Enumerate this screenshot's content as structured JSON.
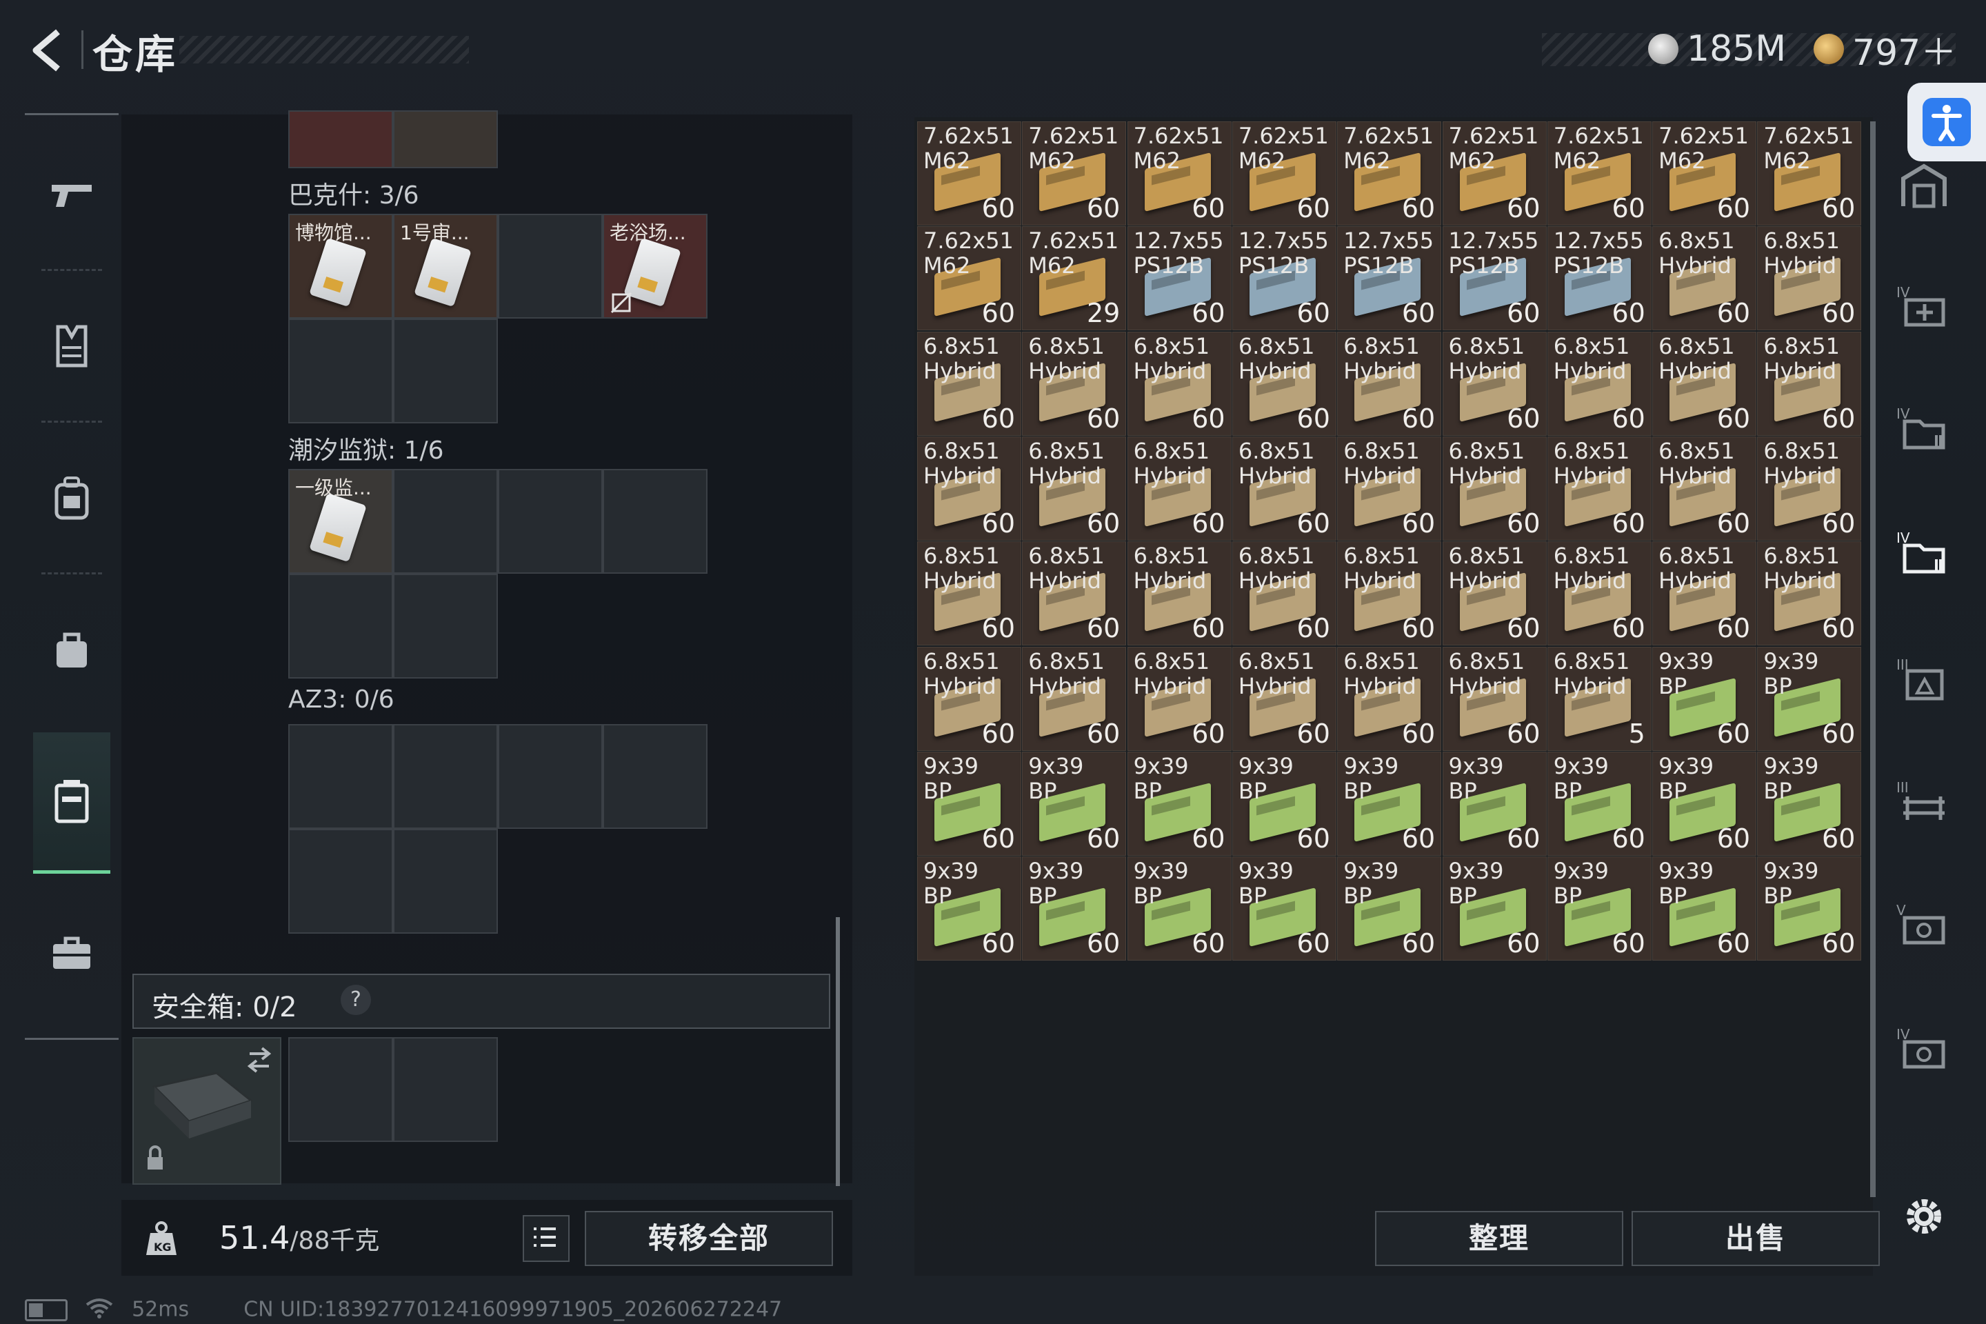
{
  "header": {
    "title": "仓库"
  },
  "currency": [
    {
      "name": "silver-coin",
      "value": "185M",
      "color": "#c8c8c8"
    },
    {
      "name": "gold-coin",
      "value": "797＋",
      "color": "#d4a04a"
    }
  ],
  "left_nav": [
    {
      "icon": "pistol-icon"
    },
    {
      "icon": "vest-icon"
    },
    {
      "icon": "backpack-icon"
    },
    {
      "icon": "bag-icon"
    },
    {
      "icon": "case-icon",
      "active": true
    },
    {
      "icon": "briefcase-icon"
    }
  ],
  "containers": [
    {
      "label": "巴克什: 3/6",
      "cells": [
        {
          "label": "博物馆..."
        },
        {
          "label": "1号审..."
        },
        {
          "label": ""
        },
        {
          "label": "老浴场..."
        }
      ]
    },
    {
      "label": "潮汐监狱: 1/6",
      "cells": [
        {
          "label": "一级监..."
        }
      ]
    },
    {
      "label": "AZ3: 0/6"
    }
  ],
  "safe": {
    "label": "安全箱: 0/2",
    "help": "?"
  },
  "footer": {
    "weight_current": "51.4",
    "weight_max": "/88千克",
    "transfer_all": "转移全部",
    "sort": "整理",
    "sell": "出售"
  },
  "warehouse": [
    {
      "name": "7.62x51\nM62",
      "count": "60",
      "kind": "m62"
    },
    {
      "name": "7.62x51\nM62",
      "count": "60",
      "kind": "m62"
    },
    {
      "name": "7.62x51\nM62",
      "count": "60",
      "kind": "m62"
    },
    {
      "name": "7.62x51\nM62",
      "count": "60",
      "kind": "m62"
    },
    {
      "name": "7.62x51\nM62",
      "count": "60",
      "kind": "m62"
    },
    {
      "name": "7.62x51\nM62",
      "count": "60",
      "kind": "m62"
    },
    {
      "name": "7.62x51\nM62",
      "count": "60",
      "kind": "m62"
    },
    {
      "name": "7.62x51\nM62",
      "count": "60",
      "kind": "m62"
    },
    {
      "name": "7.62x51\nM62",
      "count": "60",
      "kind": "m62"
    },
    {
      "name": "7.62x51\nM62",
      "count": "60",
      "kind": "m62"
    },
    {
      "name": "7.62x51\nM62",
      "count": "29",
      "kind": "m62"
    },
    {
      "name": "12.7x55\nPS12B",
      "count": "60",
      "kind": "ps"
    },
    {
      "name": "12.7x55\nPS12B",
      "count": "60",
      "kind": "ps"
    },
    {
      "name": "12.7x55\nPS12B",
      "count": "60",
      "kind": "ps"
    },
    {
      "name": "12.7x55\nPS12B",
      "count": "60",
      "kind": "ps"
    },
    {
      "name": "12.7x55\nPS12B",
      "count": "60",
      "kind": "ps"
    },
    {
      "name": "6.8x51\nHybrid",
      "count": "60",
      "kind": "hy"
    },
    {
      "name": "6.8x51\nHybrid",
      "count": "60",
      "kind": "hy"
    },
    {
      "name": "6.8x51\nHybrid",
      "count": "60",
      "kind": "hy"
    },
    {
      "name": "6.8x51\nHybrid",
      "count": "60",
      "kind": "hy"
    },
    {
      "name": "6.8x51\nHybrid",
      "count": "60",
      "kind": "hy"
    },
    {
      "name": "6.8x51\nHybrid",
      "count": "60",
      "kind": "hy"
    },
    {
      "name": "6.8x51\nHybrid",
      "count": "60",
      "kind": "hy"
    },
    {
      "name": "6.8x51\nHybrid",
      "count": "60",
      "kind": "hy"
    },
    {
      "name": "6.8x51\nHybrid",
      "count": "60",
      "kind": "hy"
    },
    {
      "name": "6.8x51\nHybrid",
      "count": "60",
      "kind": "hy"
    },
    {
      "name": "6.8x51\nHybrid",
      "count": "60",
      "kind": "hy"
    },
    {
      "name": "6.8x51\nHybrid",
      "count": "60",
      "kind": "hy"
    },
    {
      "name": "6.8x51\nHybrid",
      "count": "60",
      "kind": "hy"
    },
    {
      "name": "6.8x51\nHybrid",
      "count": "60",
      "kind": "hy"
    },
    {
      "name": "6.8x51\nHybrid",
      "count": "60",
      "kind": "hy"
    },
    {
      "name": "6.8x51\nHybrid",
      "count": "60",
      "kind": "hy"
    },
    {
      "name": "6.8x51\nHybrid",
      "count": "60",
      "kind": "hy"
    },
    {
      "name": "6.8x51\nHybrid",
      "count": "60",
      "kind": "hy"
    },
    {
      "name": "6.8x51\nHybrid",
      "count": "60",
      "kind": "hy"
    },
    {
      "name": "6.8x51\nHybrid",
      "count": "60",
      "kind": "hy"
    },
    {
      "name": "6.8x51\nHybrid",
      "count": "60",
      "kind": "hy"
    },
    {
      "name": "6.8x51\nHybrid",
      "count": "60",
      "kind": "hy"
    },
    {
      "name": "6.8x51\nHybrid",
      "count": "60",
      "kind": "hy"
    },
    {
      "name": "6.8x51\nHybrid",
      "count": "60",
      "kind": "hy"
    },
    {
      "name": "6.8x51\nHybrid",
      "count": "60",
      "kind": "hy"
    },
    {
      "name": "6.8x51\nHybrid",
      "count": "60",
      "kind": "hy"
    },
    {
      "name": "6.8x51\nHybrid",
      "count": "60",
      "kind": "hy"
    },
    {
      "name": "6.8x51\nHybrid",
      "count": "60",
      "kind": "hy"
    },
    {
      "name": "6.8x51\nHybrid",
      "count": "60",
      "kind": "hy"
    },
    {
      "name": "6.8x51\nHybrid",
      "count": "60",
      "kind": "hy"
    },
    {
      "name": "6.8x51\nHybrid",
      "count": "60",
      "kind": "hy"
    },
    {
      "name": "6.8x51\nHybrid",
      "count": "60",
      "kind": "hy"
    },
    {
      "name": "6.8x51\nHybrid",
      "count": "60",
      "kind": "hy"
    },
    {
      "name": "6.8x51\nHybrid",
      "count": "60",
      "kind": "hy"
    },
    {
      "name": "6.8x51\nHybrid",
      "count": "60",
      "kind": "hy"
    },
    {
      "name": "6.8x51\nHybrid",
      "count": "5",
      "kind": "hy"
    },
    {
      "name": "9x39\nBP",
      "count": "60",
      "kind": "bp"
    },
    {
      "name": "9x39\nBP",
      "count": "60",
      "kind": "bp"
    },
    {
      "name": "9x39\nBP",
      "count": "60",
      "kind": "bp"
    },
    {
      "name": "9x39\nBP",
      "count": "60",
      "kind": "bp"
    },
    {
      "name": "9x39\nBP",
      "count": "60",
      "kind": "bp"
    },
    {
      "name": "9x39\nBP",
      "count": "60",
      "kind": "bp"
    },
    {
      "name": "9x39\nBP",
      "count": "60",
      "kind": "bp"
    },
    {
      "name": "9x39\nBP",
      "count": "60",
      "kind": "bp"
    },
    {
      "name": "9x39\nBP",
      "count": "60",
      "kind": "bp"
    },
    {
      "name": "9x39\nBP",
      "count": "60",
      "kind": "bp"
    },
    {
      "name": "9x39\nBP",
      "count": "60",
      "kind": "bp"
    },
    {
      "name": "9x39\nBP",
      "count": "60",
      "kind": "bp"
    },
    {
      "name": "9x39\nBP",
      "count": "60",
      "kind": "bp"
    },
    {
      "name": "9x39\nBP",
      "count": "60",
      "kind": "bp"
    },
    {
      "name": "9x39\nBP",
      "count": "60",
      "kind": "bp"
    },
    {
      "name": "9x39\nBP",
      "count": "60",
      "kind": "bp"
    },
    {
      "name": "9x39\nBP",
      "count": "60",
      "kind": "bp"
    },
    {
      "name": "9x39\nBP",
      "count": "60",
      "kind": "bp"
    },
    {
      "name": "9x39\nBP",
      "count": "60",
      "kind": "bp"
    },
    {
      "name": "9x39\nBP",
      "count": "60",
      "kind": "bp"
    }
  ],
  "ammo_colors": {
    "m62": "#c59a52",
    "ps": "#8ea7b8",
    "hy": "#b8a27a",
    "bp": "#9fc26a"
  },
  "right_nav": [
    {
      "icon": "warehouse-icon"
    },
    {
      "icon": "add-storage-icon"
    },
    {
      "icon": "folder-storage-icon"
    },
    {
      "icon": "folder-storage-active-icon"
    },
    {
      "icon": "box-storage-icon"
    },
    {
      "icon": "rack-storage-icon"
    },
    {
      "icon": "vault-storage-icon"
    },
    {
      "icon": "vault-storage-2-icon"
    }
  ],
  "status": {
    "ping": "52ms",
    "uid": "CN UID:1839277012416099971905_202606272247"
  }
}
